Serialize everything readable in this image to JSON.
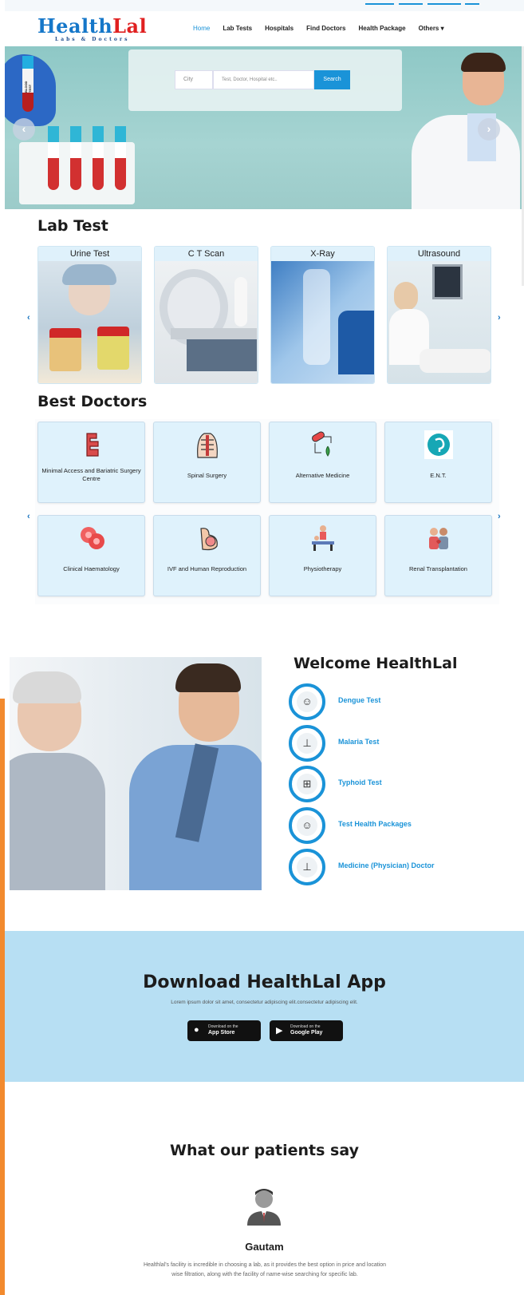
{
  "brand": {
    "name_part1": "Health",
    "name_part2": "Lal",
    "tagline": "Labs & Doctors"
  },
  "nav": {
    "items": [
      {
        "label": "Home",
        "active": true
      },
      {
        "label": "Lab Tests"
      },
      {
        "label": "Hospitals"
      },
      {
        "label": "Find Doctors"
      },
      {
        "label": "Health Package"
      },
      {
        "label": "Others ▾"
      }
    ]
  },
  "hero": {
    "city_placeholder": "City",
    "query_placeholder": "Test, Doctor, Hospital etc..",
    "search_label": "Search",
    "tube_label": "BLOOD TEST",
    "prev": "‹",
    "next": "›"
  },
  "lab_test": {
    "title": "Lab Test",
    "cards": [
      {
        "label": "Urine Test"
      },
      {
        "label": "C T Scan"
      },
      {
        "label": "X-Ray"
      },
      {
        "label": "Ultrasound"
      }
    ],
    "prev": "‹",
    "next": "›"
  },
  "best_doctors": {
    "title": "Best Doctors",
    "prev": "‹",
    "next": "›",
    "specialties": [
      {
        "label": "Minimal Access and Bariatric Surgery Centre",
        "icon": "intestine-icon"
      },
      {
        "label": "Spinal Surgery",
        "icon": "spine-icon"
      },
      {
        "label": "Alternative Medicine",
        "icon": "capsule-herb-icon"
      },
      {
        "label": "E.N.T.",
        "icon": "ent-icon"
      },
      {
        "label": "Clinical Haematology",
        "icon": "blood-cells-icon"
      },
      {
        "label": "IVF and Human Reproduction",
        "icon": "pregnancy-icon"
      },
      {
        "label": "Physiotherapy",
        "icon": "physiotherapy-icon"
      },
      {
        "label": "Renal Transplantation",
        "icon": "kidney-icon"
      }
    ]
  },
  "welcome": {
    "title": "Welcome HealthLal",
    "items": [
      {
        "label": "Dengue Test",
        "icon": "doctor-icon"
      },
      {
        "label": "Malaria Test",
        "icon": "bed-icon"
      },
      {
        "label": "Typhoid Test",
        "icon": "network-icon"
      },
      {
        "label": "Test Health Packages",
        "icon": "doctor-icon"
      },
      {
        "label": "Medicine (Physician) Doctor",
        "icon": "bed-icon"
      }
    ]
  },
  "download": {
    "title": "Download HealthLal App",
    "subtitle": "Lorem ipsum dolor sit amet, consectetur adipiscing elit.consectetur adipiscing elit.",
    "app_store": {
      "line1": "Download on the",
      "line2": "App Store"
    },
    "google_play": {
      "line1": "Download on the",
      "line2": "Google Play"
    }
  },
  "testimonials": {
    "title": "What our patients say",
    "name": "Gautam",
    "quote": "Healthlal's facility is incredible in choosing a lab, as it provides the best option in price and location wise filtration, along with the facility of name-wise searching for specific lab."
  },
  "colors": {
    "accent": "#1a93d8",
    "brand_blue": "#1577c9",
    "brand_red": "#e02020",
    "card_bg": "#dff2fc",
    "download_bg": "#b7dff3"
  }
}
